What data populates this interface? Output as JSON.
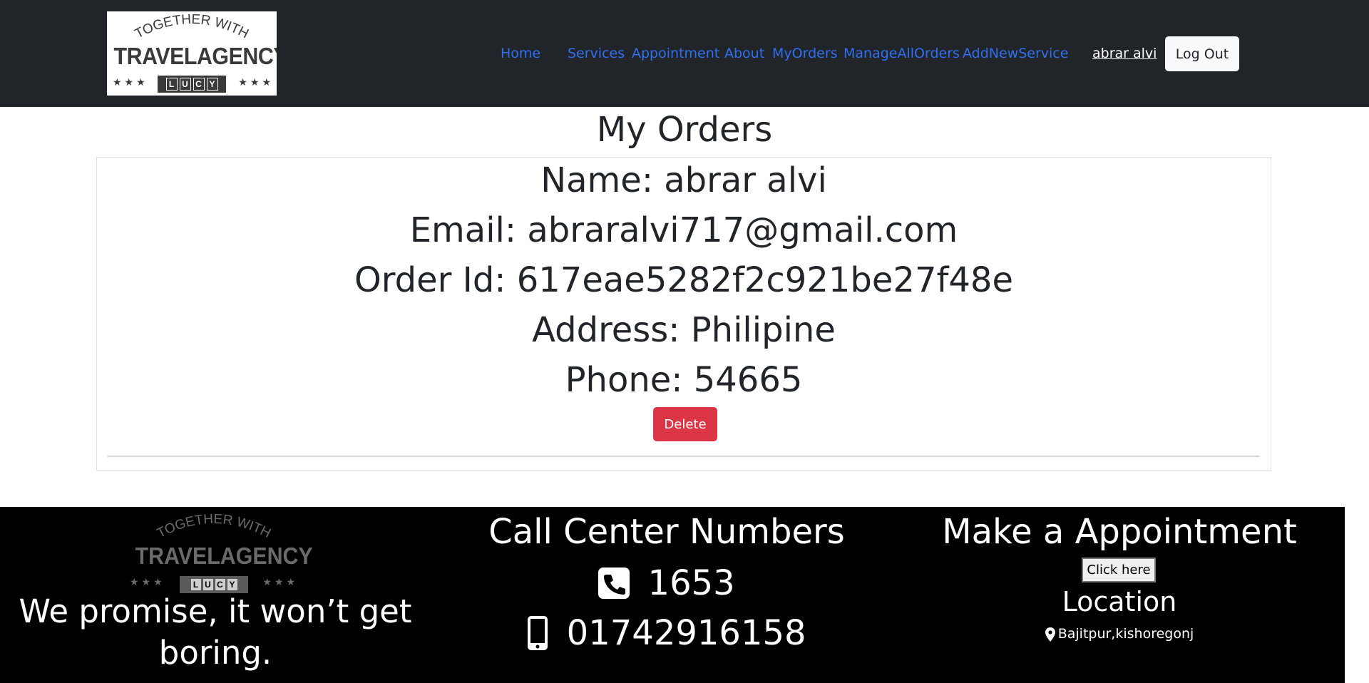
{
  "navbar": {
    "logo": {
      "arc_text": "TOGETHER WITH",
      "brand": "TRAVELAGENCY",
      "badge_letters": [
        "L",
        "U",
        "C",
        "Y"
      ]
    },
    "links": [
      "Home",
      "Services",
      "Appointment",
      "About",
      "MyOrders",
      "ManageAllOrders",
      "AddNewService"
    ],
    "user_name": "abrar alvi",
    "logout_label": "Log Out",
    "link_color": "#2f6ff0",
    "bg_color": "#212529"
  },
  "main": {
    "title": "My Orders",
    "order": {
      "name": "Name: abrar alvi",
      "email": "Email: abraralvi717@gmail.com",
      "order_id": "Order Id: 617eae5282f2c921be27f48e",
      "address": "Address: Philipine",
      "phone": "Phone: 54665",
      "delete_label": "Delete",
      "delete_color": "#dc3545"
    }
  },
  "footer": {
    "logo": {
      "arc_text": "TOGETHER WITH",
      "brand": "TRAVELAGENCY",
      "badge_letters": [
        "L",
        "U",
        "C",
        "Y"
      ]
    },
    "tagline": "We promise, it won’t get boring.",
    "call_center": {
      "title": "Call Center Numbers",
      "phone_icon": "phone-square-icon",
      "phone": "1653",
      "mobile_icon": "mobile-icon",
      "mobile": "01742916158"
    },
    "appointment": {
      "title": "Make a Appointment",
      "button_label": "Click here",
      "location_title": "Location",
      "location_icon": "map-pin-icon",
      "location": "Bajitpur,kishoregonj"
    }
  }
}
